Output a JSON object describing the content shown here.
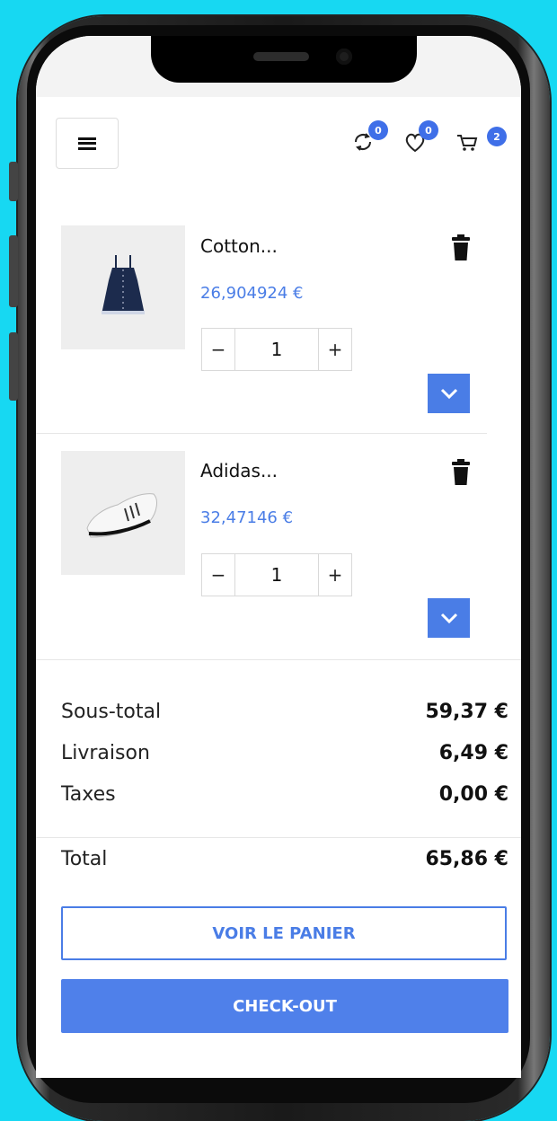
{
  "header": {
    "compare_badge": "0",
    "wishlist_badge": "0",
    "cart_badge": "2"
  },
  "cart": {
    "items": [
      {
        "name": "Cotton...",
        "price": "26,904924 €",
        "quantity": "1",
        "image_icon": "dress-image",
        "minus": "−",
        "plus": "+"
      },
      {
        "name": "Adidas...",
        "price": "32,47146 €",
        "quantity": "1",
        "image_icon": "sneaker-image",
        "minus": "−",
        "plus": "+"
      }
    ]
  },
  "totals": {
    "subtotal_label": "Sous-total",
    "subtotal_value": "59,37 €",
    "shipping_label": "Livraison",
    "shipping_value": "6,49 €",
    "taxes_label": "Taxes",
    "taxes_value": "0,00 €",
    "total_label": "Total",
    "total_value": "65,86 €"
  },
  "actions": {
    "view_cart": "VOIR LE PANIER",
    "checkout": "CHECK-OUT"
  },
  "colors": {
    "accent": "#4a7de6",
    "badge": "#3f6fe8",
    "background": "#17d8f2"
  }
}
